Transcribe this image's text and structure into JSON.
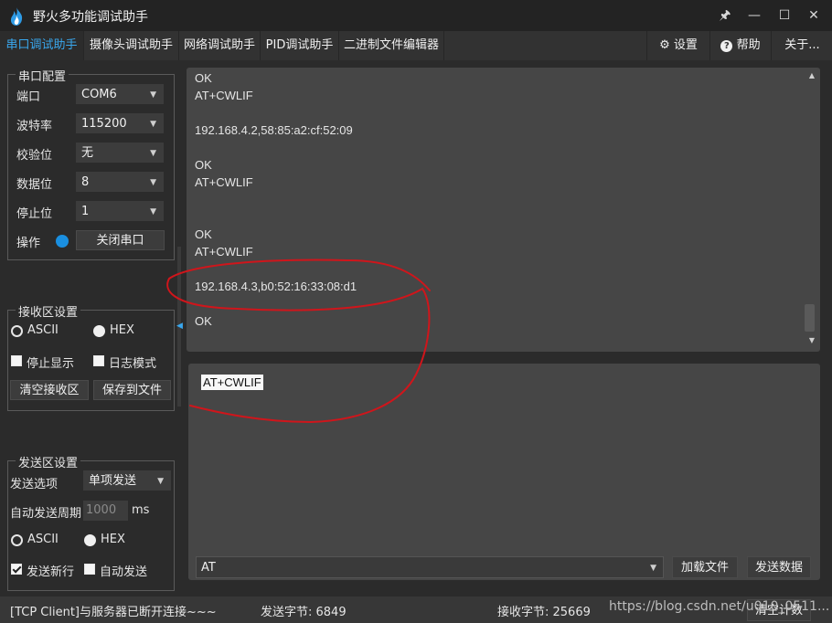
{
  "app": {
    "title": "野火多功能调试助手"
  },
  "window_controls": {
    "pin": "🖈",
    "minimize": "—",
    "maximize": "☐",
    "close": "✕"
  },
  "tabs": [
    {
      "label": "串口调试助手"
    },
    {
      "label": "摄像头调试助手"
    },
    {
      "label": "网络调试助手"
    },
    {
      "label": "PID调试助手"
    },
    {
      "label": "二进制文件编辑器"
    }
  ],
  "top_right": {
    "settings": "设置",
    "help": "帮助",
    "about": "关于..."
  },
  "serial_config": {
    "title": "串口配置",
    "port_label": "端口",
    "port_value": "COM6",
    "baud_label": "波特率",
    "baud_value": "115200",
    "parity_label": "校验位",
    "parity_value": "无",
    "databits_label": "数据位",
    "databits_value": "8",
    "stopbits_label": "停止位",
    "stopbits_value": "1",
    "op_label": "操作",
    "close_port_button": "关闭串口",
    "status_color": "#1a8fe0"
  },
  "recv_settings": {
    "title": "接收区设置",
    "ascii": "ASCII",
    "hex": "HEX",
    "stop_display": "停止显示",
    "log_mode": "日志模式",
    "clear_button": "清空接收区",
    "save_button": "保存到文件"
  },
  "send_settings": {
    "title": "发送区设置",
    "option_label": "发送选项",
    "option_value": "单项发送",
    "period_label": "自动发送周期",
    "period_value": "1000",
    "period_unit": "ms",
    "ascii": "ASCII",
    "hex": "HEX",
    "newline": "发送新行",
    "auto_send": "自动发送"
  },
  "recv_lines": [
    "OK",
    "AT+CWLIF",
    "",
    "192.168.4.2,58:85:a2:cf:52:09",
    "",
    "OK",
    "AT+CWLIF",
    "",
    "",
    "OK",
    "AT+CWLIF",
    "",
    "192.168.4.3,b0:52:16:33:08:d1",
    "",
    "OK"
  ],
  "send_text": "AT+CWLIF",
  "bottom": {
    "command_value": "AT",
    "load_file_button": "加载文件",
    "send_button": "发送数据"
  },
  "status": {
    "connection": "[TCP Client]与服务器已断开连接~~~",
    "sent_bytes": "发送字节: 6849",
    "recv_bytes": "接收字节: 25669",
    "clear_count_button": "清空计数",
    "watermark": "https://blog.csdn.net/u010_0511..."
  },
  "colors": {
    "accent": "#39a7ee",
    "annotation": "#d0151b"
  }
}
